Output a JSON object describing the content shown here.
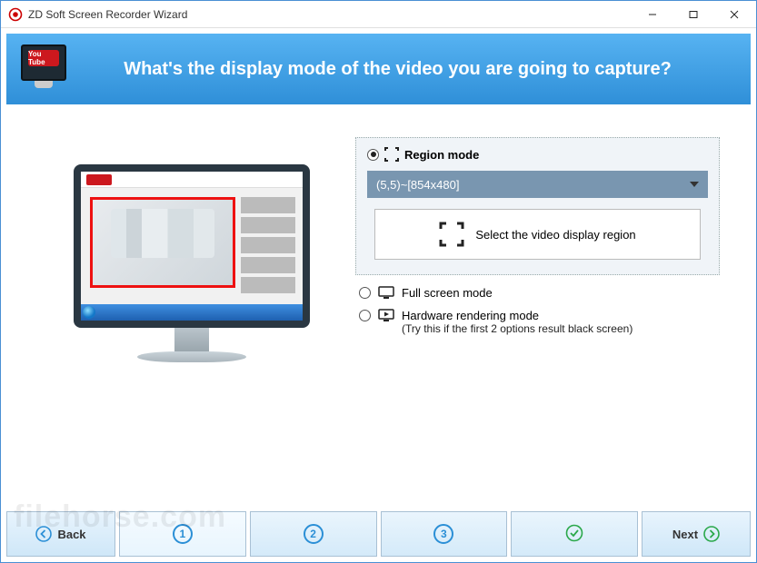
{
  "titlebar": {
    "title": "ZD Soft Screen Recorder Wizard"
  },
  "banner": {
    "youtube_badge": "You Tube",
    "heading": "What's the display mode of the video you are going to capture?"
  },
  "options": {
    "region": {
      "label": "Region mode",
      "dropdown_value": "(5,5)~[854x480]",
      "select_button": "Select the video display region"
    },
    "fullscreen": {
      "label": "Full screen mode"
    },
    "hardware": {
      "label": "Hardware rendering mode",
      "hint": "(Try this if the first 2 options result black screen)"
    }
  },
  "footer": {
    "back": "Back",
    "next": "Next",
    "steps": [
      "1",
      "2",
      "3"
    ]
  },
  "watermark": "filehorse.com"
}
